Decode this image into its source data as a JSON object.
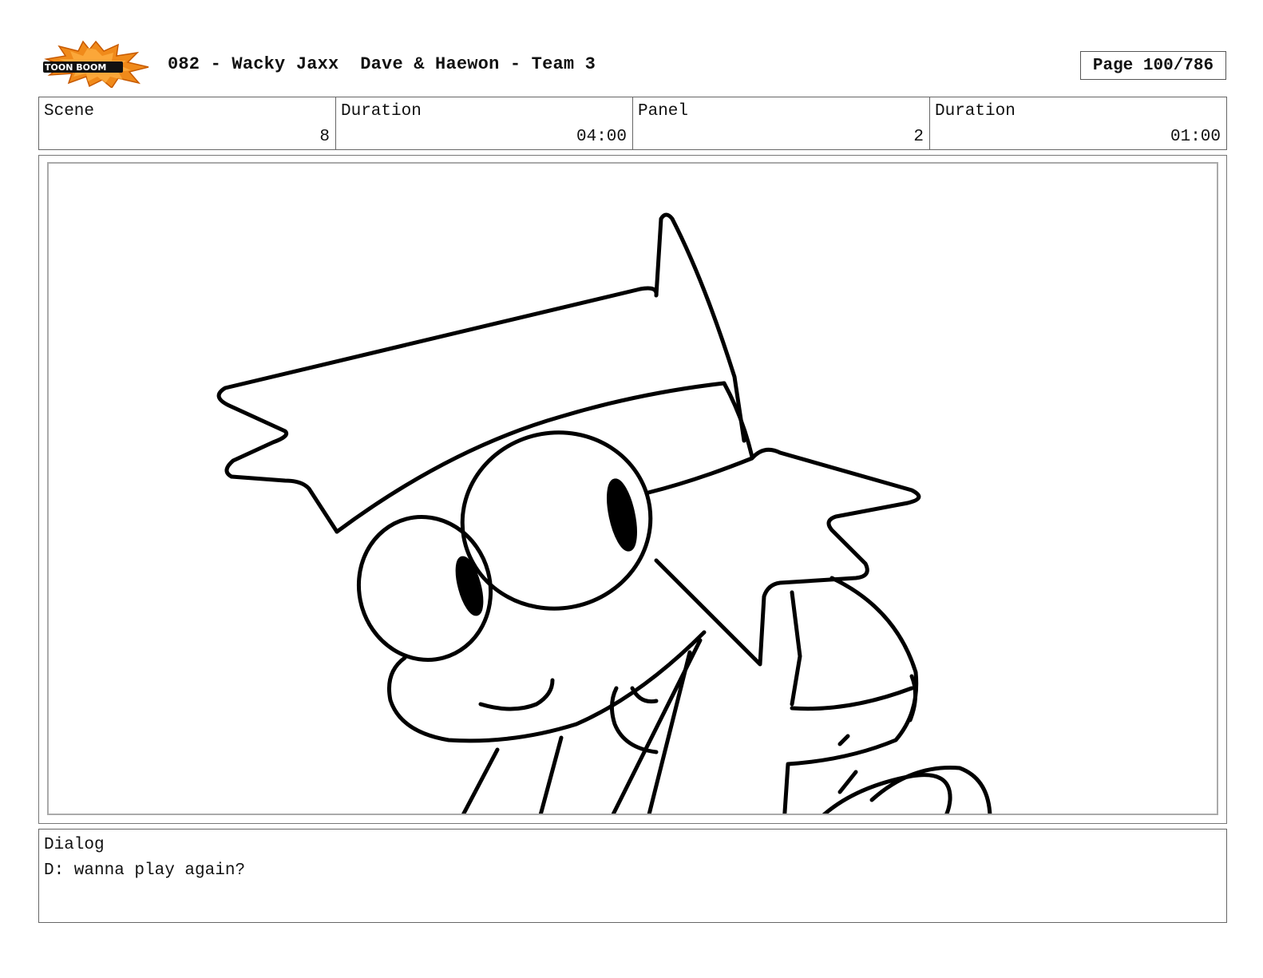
{
  "header": {
    "logo_text": "TOONBOOM",
    "title": "082 - Wacky Jaxx  Dave & Haewon - Team 3",
    "page": "Page 100/786"
  },
  "info": {
    "scene_label": "Scene",
    "scene_value": "8",
    "scene_duration_label": "Duration",
    "scene_duration_value": "04:00",
    "panel_label": "Panel",
    "panel_value": "2",
    "panel_duration_label": "Duration",
    "panel_duration_value": "01:00"
  },
  "dialog": {
    "label": "Dialog",
    "text": "D: wanna play again?"
  },
  "colors": {
    "logo_orange": "#f08a1a",
    "logo_black": "#111111",
    "line": "#000000"
  }
}
